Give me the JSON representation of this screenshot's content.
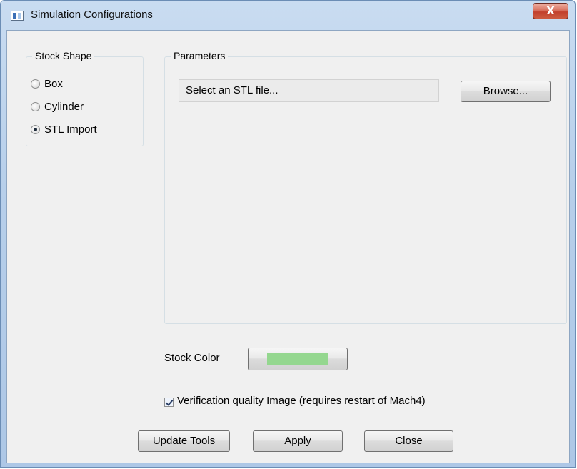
{
  "window": {
    "title": "Simulation Configurations",
    "close_glyph": "X"
  },
  "stock_shape": {
    "label": "Stock Shape",
    "options": [
      {
        "label": "Box",
        "checked": false
      },
      {
        "label": "Cylinder",
        "checked": false
      },
      {
        "label": "STL Import",
        "checked": true
      }
    ]
  },
  "parameters": {
    "label": "Parameters",
    "file_field_text": "Select an STL file...",
    "browse_label": "Browse..."
  },
  "stock_color": {
    "label": "Stock Color",
    "color": "#94d78f"
  },
  "verification": {
    "label": "Verification quality Image (requires restart of Mach4)",
    "checked": true
  },
  "footer": {
    "update_tools_label": "Update Tools",
    "apply_label": "Apply",
    "close_label": "Close"
  }
}
